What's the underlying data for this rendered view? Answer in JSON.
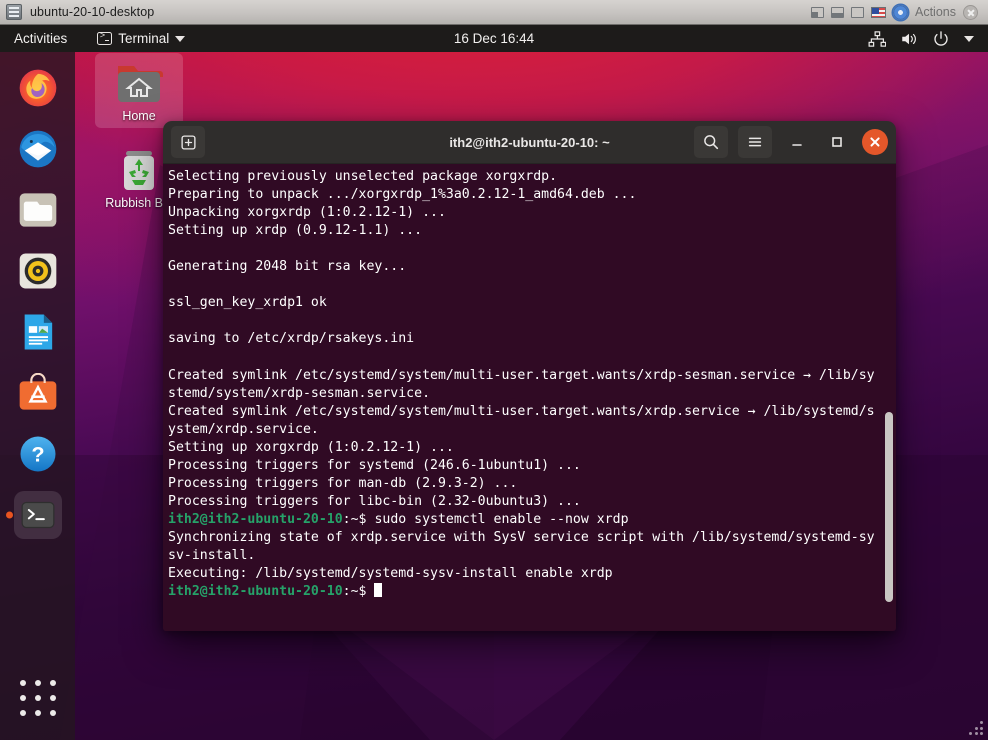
{
  "vm_window": {
    "title": "ubuntu-20-10-desktop",
    "icon": "vm-screen-icon",
    "actions_label": "Actions",
    "controls": [
      "minimize-restore-icon",
      "half-screen-icon",
      "full-screen-icon",
      "keyboard-flag-icon",
      "settings-gear-icon"
    ],
    "close_icon": "close-icon"
  },
  "topbar": {
    "activities": "Activities",
    "app_menu": {
      "label": "Terminal",
      "icon": "terminal-icon",
      "caret": "chevron-down-icon"
    },
    "clock": "16 Dec  16:44",
    "tray": [
      "network-icon",
      "volume-icon",
      "power-icon",
      "chevron-down-icon"
    ]
  },
  "dock": {
    "items": [
      {
        "name": "firefox",
        "label": "Firefox Web Browser",
        "active": false
      },
      {
        "name": "thunderbird",
        "label": "Thunderbird Mail",
        "active": false
      },
      {
        "name": "files",
        "label": "Files",
        "active": false
      },
      {
        "name": "rhythmbox",
        "label": "Rhythmbox",
        "active": false
      },
      {
        "name": "libreoffice-writer",
        "label": "LibreOffice Writer",
        "active": false
      },
      {
        "name": "ubuntu-software",
        "label": "Ubuntu Software",
        "active": false
      },
      {
        "name": "help",
        "label": "Help",
        "active": false
      },
      {
        "name": "terminal",
        "label": "Terminal",
        "active": true
      }
    ],
    "show_applications": "Show Applications"
  },
  "desktop_icons": [
    {
      "name": "home",
      "label": "Home",
      "selected": true
    },
    {
      "name": "rubbish",
      "label": "Rubbish Bin",
      "selected": false
    }
  ],
  "terminal": {
    "title": "ith2@ith2-ubuntu-20-10: ~",
    "new_tab_icon": "new-tab-icon",
    "search_icon": "search-icon",
    "menu_icon": "hamburger-menu-icon",
    "minimize_icon": "minimize-icon",
    "maximize_icon": "maximize-icon",
    "close_icon": "close-icon",
    "colors": {
      "background": "#300a24",
      "foreground": "#ffffff",
      "prompt_green": "#26a269",
      "prompt_blue": "#2a7bde"
    },
    "prompt": "ith2@ith2-ubuntu-20-10",
    "prompt_path": ":~$ ",
    "lines": [
      {
        "type": "out",
        "text": "Selecting previously unselected package xorgxrdp."
      },
      {
        "type": "out",
        "text": "Preparing to unpack .../xorgxrdp_1%3a0.2.12-1_amd64.deb ..."
      },
      {
        "type": "out",
        "text": "Unpacking xorgxrdp (1:0.2.12-1) ..."
      },
      {
        "type": "out",
        "text": "Setting up xrdp (0.9.12-1.1) ..."
      },
      {
        "type": "out",
        "text": ""
      },
      {
        "type": "out",
        "text": "Generating 2048 bit rsa key..."
      },
      {
        "type": "out",
        "text": ""
      },
      {
        "type": "out",
        "text": "ssl_gen_key_xrdp1 ok"
      },
      {
        "type": "out",
        "text": ""
      },
      {
        "type": "out",
        "text": "saving to /etc/xrdp/rsakeys.ini"
      },
      {
        "type": "out",
        "text": ""
      },
      {
        "type": "out",
        "text": "Created symlink /etc/systemd/system/multi-user.target.wants/xrdp-sesman.service → /lib/systemd/system/xrdp-sesman.service."
      },
      {
        "type": "out",
        "text": "Created symlink /etc/systemd/system/multi-user.target.wants/xrdp.service → /lib/systemd/system/xrdp.service."
      },
      {
        "type": "out",
        "text": "Setting up xorgxrdp (1:0.2.12-1) ..."
      },
      {
        "type": "out",
        "text": "Processing triggers for systemd (246.6-1ubuntu1) ..."
      },
      {
        "type": "out",
        "text": "Processing triggers for man-db (2.9.3-2) ..."
      },
      {
        "type": "out",
        "text": "Processing triggers for libc-bin (2.32-0ubuntu3) ..."
      },
      {
        "type": "cmd",
        "text": "sudo systemctl enable --now xrdp"
      },
      {
        "type": "out",
        "text": "Synchronizing state of xrdp.service with SysV service script with /lib/systemd/systemd-sysv-install."
      },
      {
        "type": "out",
        "text": "Executing: /lib/systemd/systemd-sysv-install enable xrdp"
      },
      {
        "type": "prompt",
        "text": ""
      }
    ]
  }
}
